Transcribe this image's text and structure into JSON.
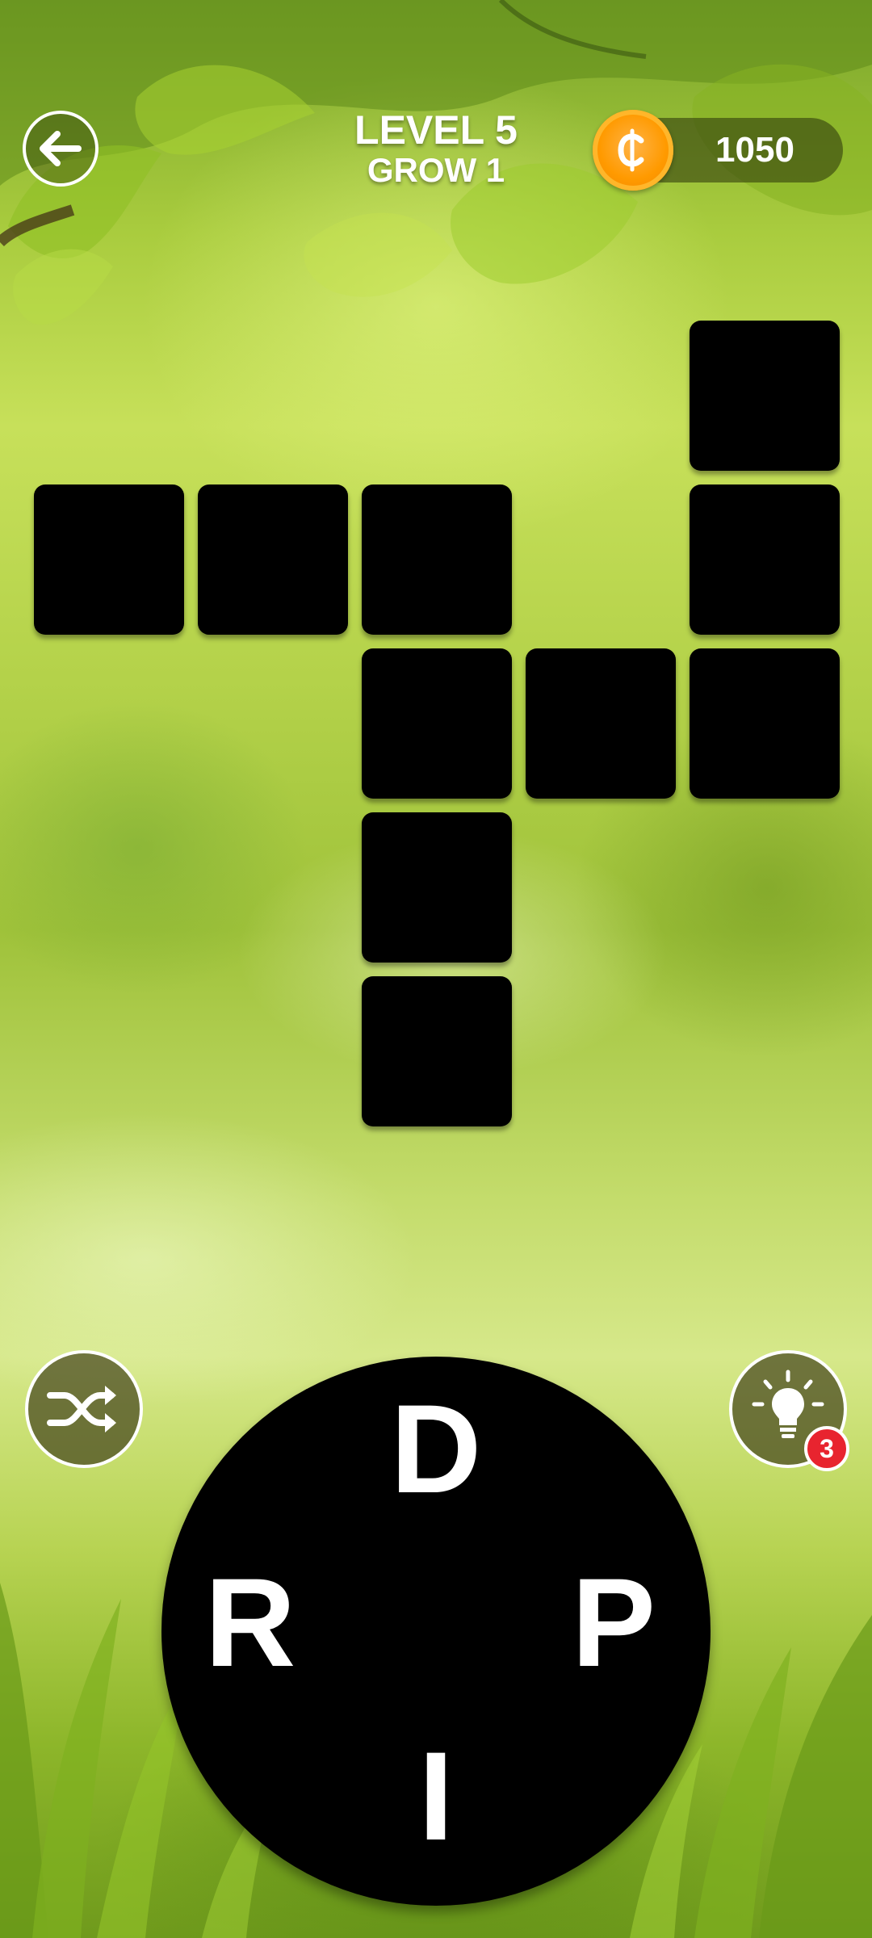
{
  "header": {
    "level_title": "LEVEL 5",
    "level_subtitle": "GROW 1",
    "coins": "1050"
  },
  "board": {
    "tiles": [
      {
        "row": 0,
        "col": 4
      },
      {
        "row": 1,
        "col": 0
      },
      {
        "row": 1,
        "col": 1
      },
      {
        "row": 1,
        "col": 2
      },
      {
        "row": 1,
        "col": 4
      },
      {
        "row": 2,
        "col": 2
      },
      {
        "row": 2,
        "col": 3
      },
      {
        "row": 2,
        "col": 4
      },
      {
        "row": 3,
        "col": 2
      },
      {
        "row": 4,
        "col": 2
      }
    ]
  },
  "hint": {
    "count": "3"
  },
  "wheel": {
    "letters": [
      {
        "char": "D",
        "position": "top"
      },
      {
        "char": "P",
        "position": "right"
      },
      {
        "char": "I",
        "position": "bottom"
      },
      {
        "char": "R",
        "position": "left"
      }
    ]
  },
  "colors": {
    "tile": "#000000",
    "wheel": "#000000",
    "coin": "#ff9a00",
    "badge": "#e8242f"
  },
  "icons": [
    "back-arrow-icon",
    "coin-icon",
    "shuffle-icon",
    "lightbulb-icon"
  ]
}
